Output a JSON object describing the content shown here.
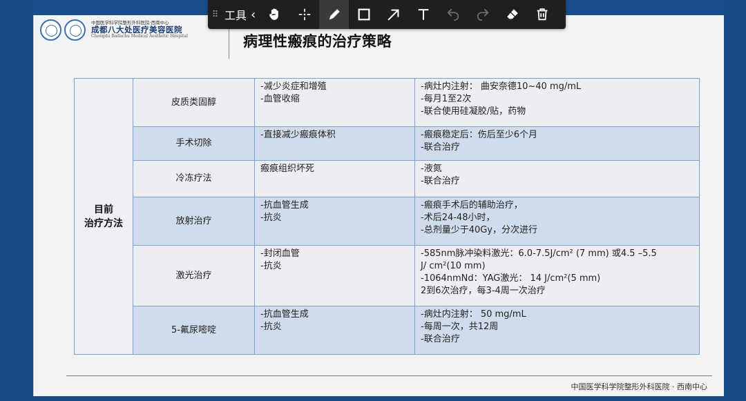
{
  "toolbar": {
    "grip": "⠿",
    "tools_label": "工具",
    "collapse_chevron": "‹",
    "tools": [
      {
        "name": "hand-icon",
        "active": false,
        "disabled": false
      },
      {
        "name": "move-icon",
        "active": false,
        "disabled": false
      },
      {
        "name": "pen-icon",
        "active": true,
        "disabled": false
      },
      {
        "name": "rectangle-icon",
        "active": false,
        "disabled": false
      },
      {
        "name": "arrow-icon",
        "active": false,
        "disabled": false
      },
      {
        "name": "text-icon",
        "active": false,
        "disabled": false
      },
      {
        "name": "undo-icon",
        "active": false,
        "disabled": true
      },
      {
        "name": "redo-icon",
        "active": false,
        "disabled": true
      },
      {
        "name": "eraser-icon",
        "active": false,
        "disabled": false
      },
      {
        "name": "trash-icon",
        "active": false,
        "disabled": false
      }
    ]
  },
  "header": {
    "logo_small": "中国医学科学院整形外科医院·西南中心",
    "logo_main": "成都八大处医疗美容医院",
    "logo_en": "Chengdu Badachu Medical Aesthetic Hospital",
    "title": "病理性瘢痕的治疗策略"
  },
  "table": {
    "category": "目前\n治疗方法",
    "rows": [
      {
        "name": "皮质类固醇",
        "mechanism": [
          "-减少炎症和增殖",
          "-血管收缩"
        ],
        "details": [
          "-病灶内注射：  曲安奈德10~40 mg/mL",
          "-每月1至2次",
          "-联合使用硅凝胶/贴，药物"
        ],
        "style": "light"
      },
      {
        "name": "手术切除",
        "mechanism": [
          "-直接减少瘢痕体积"
        ],
        "details": [
          "-瘢痕稳定后：伤后至少6个月",
          "-联合治疗"
        ],
        "style": "blue"
      },
      {
        "name": "冷冻疗法",
        "mechanism": [
          "瘢痕组织坏死"
        ],
        "details": [
          "-液氮",
          "-联合治疗"
        ],
        "style": "light"
      },
      {
        "name": "放射治疗",
        "mechanism": [
          "-抗血管生成",
          "-抗炎"
        ],
        "details": [
          "-瘢痕手术后的辅助治疗，",
          "-术后24-48小时，",
          "-总剂量少于40Gy，分次进行"
        ],
        "style": "blue"
      },
      {
        "name": "激光治疗",
        "mechanism": [
          "-封闭血管",
          "-抗炎"
        ],
        "details": [
          "-585nm脉冲染料激光：6.0-7.5J/cm² (7  mm) 或4.5 –5.5",
          "J/ cm²(10 mm)",
          "-1064nmNd：YAG激光：  14 J/cm²(5 mm)",
          "2到6次治疗，每3-4周一次治疗"
        ],
        "style": "light"
      },
      {
        "name": "5-氟尿嘧啶",
        "mechanism": [
          "-抗血管生成",
          "-抗炎"
        ],
        "details": [
          "-病灶内注射：  50 mg/mL",
          "-每周一次，共12周",
          "-联合治疗"
        ],
        "style": "blue"
      }
    ]
  },
  "footer": {
    "text": "中国医学科学院整形外科医院 · 西南中心"
  },
  "colors": {
    "frame": "#1a4a88",
    "row_blue": "#cfdcec",
    "row_light": "#eceef2",
    "border": "#7fa1c9"
  }
}
